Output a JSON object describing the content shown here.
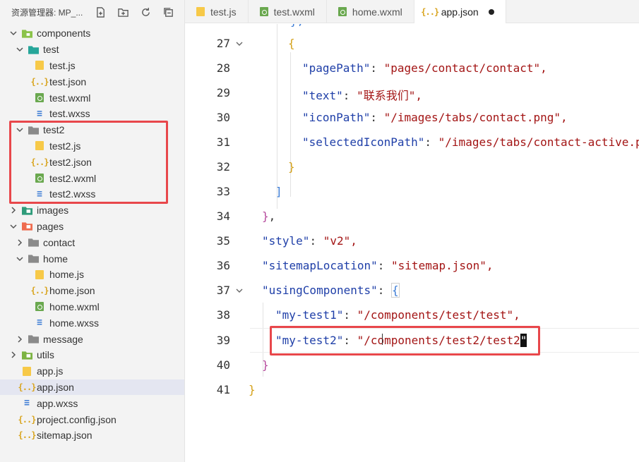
{
  "sidebar": {
    "title": "资源管理器: MP_...",
    "tree": [
      {
        "label": "components",
        "type": "folder-special",
        "depth": 0,
        "expanded": true
      },
      {
        "label": "test",
        "type": "folder-teal",
        "depth": 1,
        "expanded": true
      },
      {
        "label": "test.js",
        "type": "js",
        "depth": 2
      },
      {
        "label": "test.json",
        "type": "json",
        "depth": 2
      },
      {
        "label": "test.wxml",
        "type": "wxml",
        "depth": 2
      },
      {
        "label": "test.wxss",
        "type": "wxss",
        "depth": 2
      },
      {
        "label": "test2",
        "type": "folder",
        "depth": 1,
        "expanded": true
      },
      {
        "label": "test2.js",
        "type": "js",
        "depth": 2
      },
      {
        "label": "test2.json",
        "type": "json",
        "depth": 2
      },
      {
        "label": "test2.wxml",
        "type": "wxml",
        "depth": 2
      },
      {
        "label": "test2.wxss",
        "type": "wxss",
        "depth": 2
      },
      {
        "label": "images",
        "type": "folder-green",
        "depth": 0,
        "expanded": false
      },
      {
        "label": "pages",
        "type": "folder-red",
        "depth": 0,
        "expanded": true
      },
      {
        "label": "contact",
        "type": "folder",
        "depth": 1,
        "expanded": false
      },
      {
        "label": "home",
        "type": "folder",
        "depth": 1,
        "expanded": true
      },
      {
        "label": "home.js",
        "type": "js",
        "depth": 2
      },
      {
        "label": "home.json",
        "type": "json",
        "depth": 2
      },
      {
        "label": "home.wxml",
        "type": "wxml",
        "depth": 2
      },
      {
        "label": "home.wxss",
        "type": "wxss",
        "depth": 2
      },
      {
        "label": "message",
        "type": "folder",
        "depth": 1,
        "expanded": false
      },
      {
        "label": "utils",
        "type": "folder-green",
        "depth": 0,
        "expanded": false
      },
      {
        "label": "app.js",
        "type": "js",
        "depth": 0
      },
      {
        "label": "app.json",
        "type": "json",
        "depth": 0,
        "selected": true
      },
      {
        "label": "app.wxss",
        "type": "wxss",
        "depth": 0
      },
      {
        "label": "project.config.json",
        "type": "json",
        "depth": 0
      },
      {
        "label": "sitemap.json",
        "type": "json",
        "depth": 0
      }
    ]
  },
  "tabs": [
    {
      "label": "test.js",
      "type": "js"
    },
    {
      "label": "test.wxml",
      "type": "wxml"
    },
    {
      "label": "home.wxml",
      "type": "wxml"
    },
    {
      "label": "app.json",
      "type": "json",
      "active": true,
      "dirty": true
    }
  ],
  "editor": {
    "lines": [
      {
        "n": "27",
        "fold": true
      },
      {
        "n": "28",
        "key": "\"pagePath\"",
        "value": "\"pages/contact/contact\","
      },
      {
        "n": "29",
        "key": "\"text\"",
        "value": "\"联系我们\","
      },
      {
        "n": "30",
        "key": "\"iconPath\"",
        "value": "\"/images/tabs/contact.png\","
      },
      {
        "n": "31",
        "key": "\"selectedIconPath\"",
        "value": "\"/images/tabs/contact-active.png"
      },
      {
        "n": "32"
      },
      {
        "n": "33"
      },
      {
        "n": "34"
      },
      {
        "n": "35",
        "key": "\"style\"",
        "value": "\"v2\","
      },
      {
        "n": "36",
        "key": "\"sitemapLocation\"",
        "value": "\"sitemap.json\","
      },
      {
        "n": "37",
        "key": "\"usingComponents\"",
        "fold": true
      },
      {
        "n": "38",
        "key": "\"my-test1\"",
        "value": "\"/components/test/test\","
      },
      {
        "n": "39",
        "key": "\"my-test2\"",
        "value": "\"/components/test2/test2"
      },
      {
        "n": "40"
      },
      {
        "n": "41"
      }
    ]
  },
  "colors": {
    "highlight": "#e8474b",
    "key": "#1f3fa8",
    "string": "#a31515"
  }
}
